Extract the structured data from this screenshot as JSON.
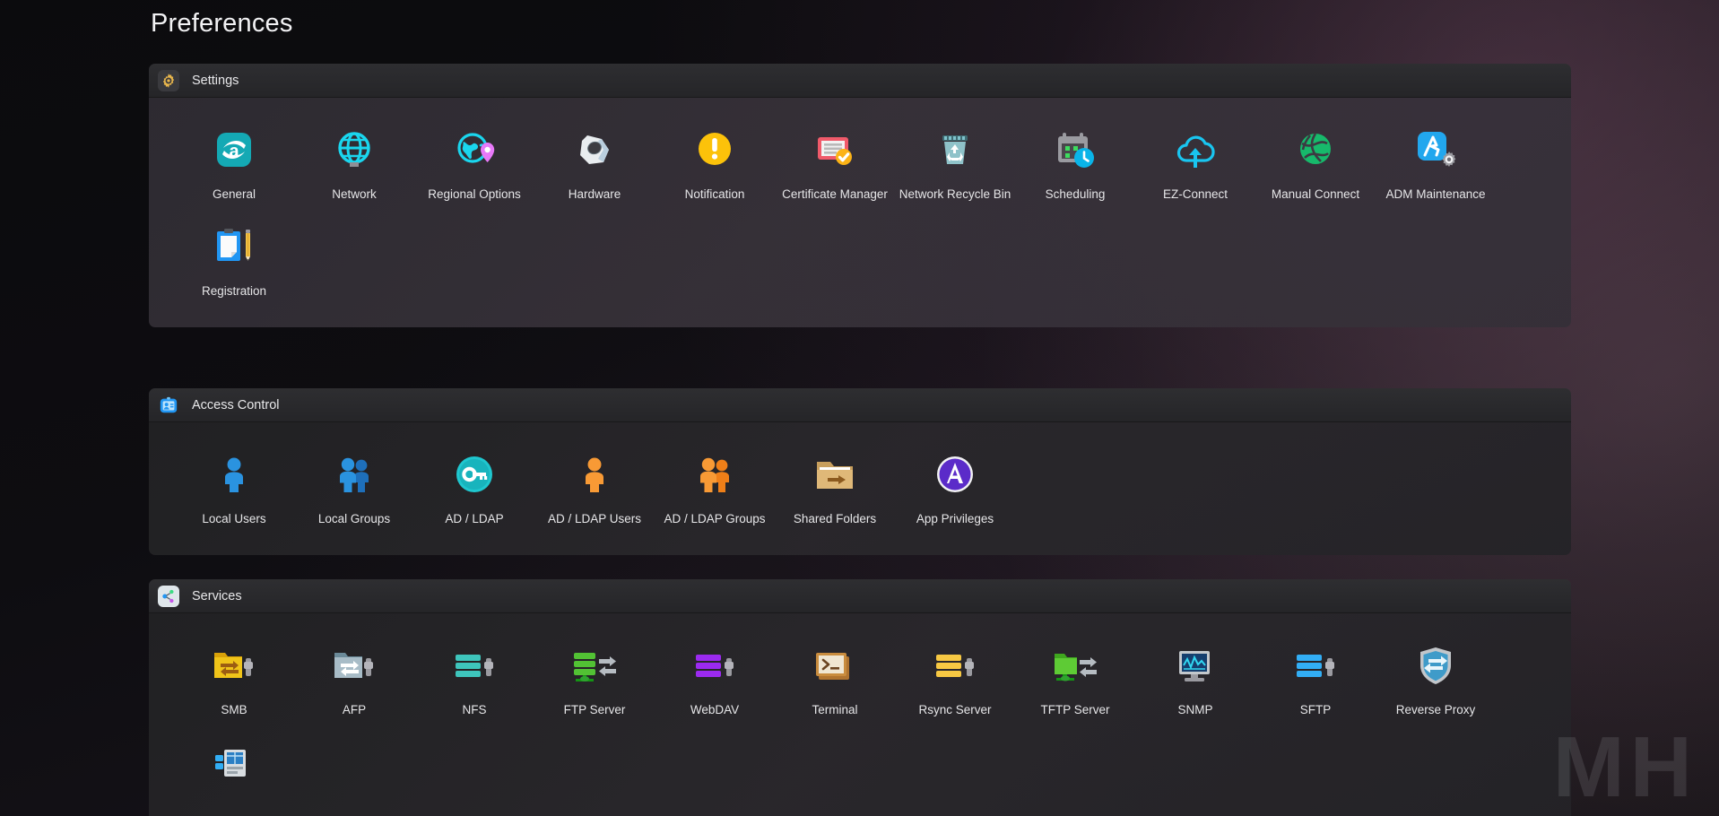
{
  "page": {
    "title": "Preferences",
    "watermark": "MH"
  },
  "colors": {
    "accent_teal": "#16b3bd",
    "accent_blue": "#2196f3",
    "accent_orange": "#f7941e",
    "accent_green": "#2eb872",
    "accent_yellow": "#fbc02d",
    "accent_purple": "#8e24aa",
    "panel_bg": "#34303a",
    "header_bg": "#2b2b2e",
    "text": "#e6e6e8"
  },
  "sections": [
    {
      "id": "settings",
      "label": "Settings",
      "icon": "gear-icon",
      "items": [
        {
          "label": "General",
          "icon": "adm-a-icon"
        },
        {
          "label": "Network",
          "icon": "globe-icon"
        },
        {
          "label": "Regional Options",
          "icon": "globe-pin-icon"
        },
        {
          "label": "Hardware",
          "icon": "nut-icon"
        },
        {
          "label": "Notification",
          "icon": "exclamation-circle-icon"
        },
        {
          "label": "Certificate Manager",
          "icon": "certificate-check-icon"
        },
        {
          "label": "Network Recycle Bin",
          "icon": "recycle-bin-icon"
        },
        {
          "label": "Scheduling",
          "icon": "calendar-clock-icon"
        },
        {
          "label": "EZ-Connect",
          "icon": "cloud-upload-icon"
        },
        {
          "label": "Manual Connect",
          "icon": "green-globe-icon"
        },
        {
          "label": "ADM Maintenance",
          "icon": "adm-gear-icon"
        },
        {
          "label": "Registration",
          "icon": "clipboard-pencil-icon"
        }
      ]
    },
    {
      "id": "access-control",
      "label": "Access Control",
      "icon": "id-badge-icon",
      "items": [
        {
          "label": "Local Users",
          "icon": "person-blue-icon"
        },
        {
          "label": "Local Groups",
          "icon": "people-blue-icon"
        },
        {
          "label": "AD / LDAP",
          "icon": "key-circle-icon"
        },
        {
          "label": "AD / LDAP Users",
          "icon": "person-orange-icon"
        },
        {
          "label": "AD / LDAP Groups",
          "icon": "people-orange-icon"
        },
        {
          "label": "Shared Folders",
          "icon": "folder-arrow-icon"
        },
        {
          "label": "App Privileges",
          "icon": "app-privileges-icon"
        }
      ]
    },
    {
      "id": "services",
      "label": "Services",
      "icon": "services-node-icon",
      "items": [
        {
          "label": "SMB",
          "icon": "smb-folder-icon"
        },
        {
          "label": "AFP",
          "icon": "afp-folder-icon"
        },
        {
          "label": "NFS",
          "icon": "nfs-server-icon"
        },
        {
          "label": "FTP Server",
          "icon": "ftp-server-icon"
        },
        {
          "label": "WebDAV",
          "icon": "webdav-server-icon"
        },
        {
          "label": "Terminal",
          "icon": "terminal-icon"
        },
        {
          "label": "Rsync Server",
          "icon": "rsync-server-icon"
        },
        {
          "label": "TFTP Server",
          "icon": "tftp-folder-icon"
        },
        {
          "label": "SNMP",
          "icon": "snmp-monitor-icon"
        },
        {
          "label": "SFTP",
          "icon": "sftp-server-icon"
        },
        {
          "label": "Reverse Proxy",
          "icon": "reverse-proxy-shield-icon"
        }
      ]
    }
  ],
  "partial_row": {
    "items": [
      {
        "label": "",
        "icon": "web-server-icon"
      }
    ]
  }
}
